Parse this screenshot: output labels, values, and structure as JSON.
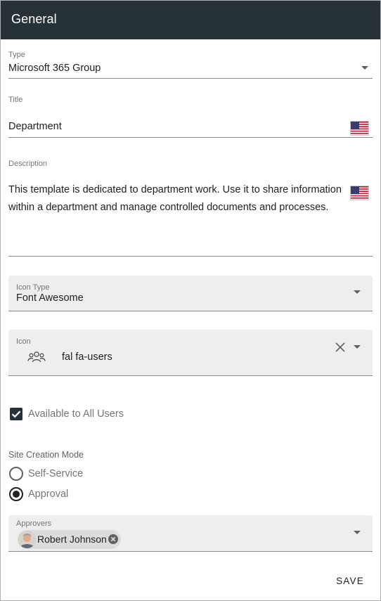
{
  "header": {
    "title": "General"
  },
  "type_field": {
    "label": "Type",
    "value": "Microsoft 365 Group"
  },
  "title_field": {
    "label": "Title",
    "value": "Department",
    "language_flag": "us-flag-icon"
  },
  "description_field": {
    "label": "Description",
    "value": "This template is dedicated to department work. Use it to share information within a department and manage controlled documents and processes.",
    "language_flag": "us-flag-icon"
  },
  "icon_type_field": {
    "label": "Icon Type",
    "value": "Font Awesome"
  },
  "icon_field": {
    "label": "Icon",
    "value": "fal fa-users",
    "preview_icon": "users-icon"
  },
  "available_checkbox": {
    "label": "Available to All Users",
    "checked": true
  },
  "site_creation_mode": {
    "label": "Site Creation Mode",
    "options": [
      {
        "label": "Self-Service",
        "selected": false
      },
      {
        "label": "Approval",
        "selected": true
      }
    ]
  },
  "approvers_field": {
    "label": "Approvers",
    "chips": [
      {
        "name": "Robert Johnson"
      }
    ]
  },
  "actions": {
    "save_label": "SAVE"
  },
  "colors": {
    "header_bg": "#263238",
    "field_bg": "#eeeeee",
    "accent": "#263238"
  }
}
